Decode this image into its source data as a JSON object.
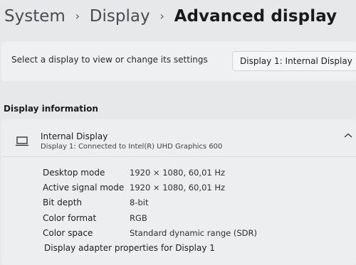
{
  "breadcrumb": {
    "root": "System",
    "parent": "Display",
    "current": "Advanced display",
    "separator": "›"
  },
  "display_selector": {
    "label": "Select a display to view or change its settings",
    "selected": "Display 1: Internal Display"
  },
  "display_information": {
    "section_title": "Display information",
    "display_name": "Internal Display",
    "connection": "Display 1: Connected to Intel(R) UHD Graphics 600",
    "properties": [
      {
        "label": "Desktop mode",
        "value": "1920 × 1080, 60,01 Hz"
      },
      {
        "label": "Active signal mode",
        "value": "1920 × 1080, 60,01 Hz"
      },
      {
        "label": "Bit depth",
        "value": "8-bit"
      },
      {
        "label": "Color format",
        "value": "RGB"
      },
      {
        "label": "Color space",
        "value": "Standard dynamic range (SDR)"
      }
    ],
    "adapter_link": "Display adapter properties for Display 1"
  },
  "icons": {
    "display": "monitor-icon",
    "collapse": "chevron-up-icon",
    "dropdown": "chevron-down-icon"
  },
  "colors": {
    "background": "#e6e8ea",
    "card": "#eceeef"
  }
}
